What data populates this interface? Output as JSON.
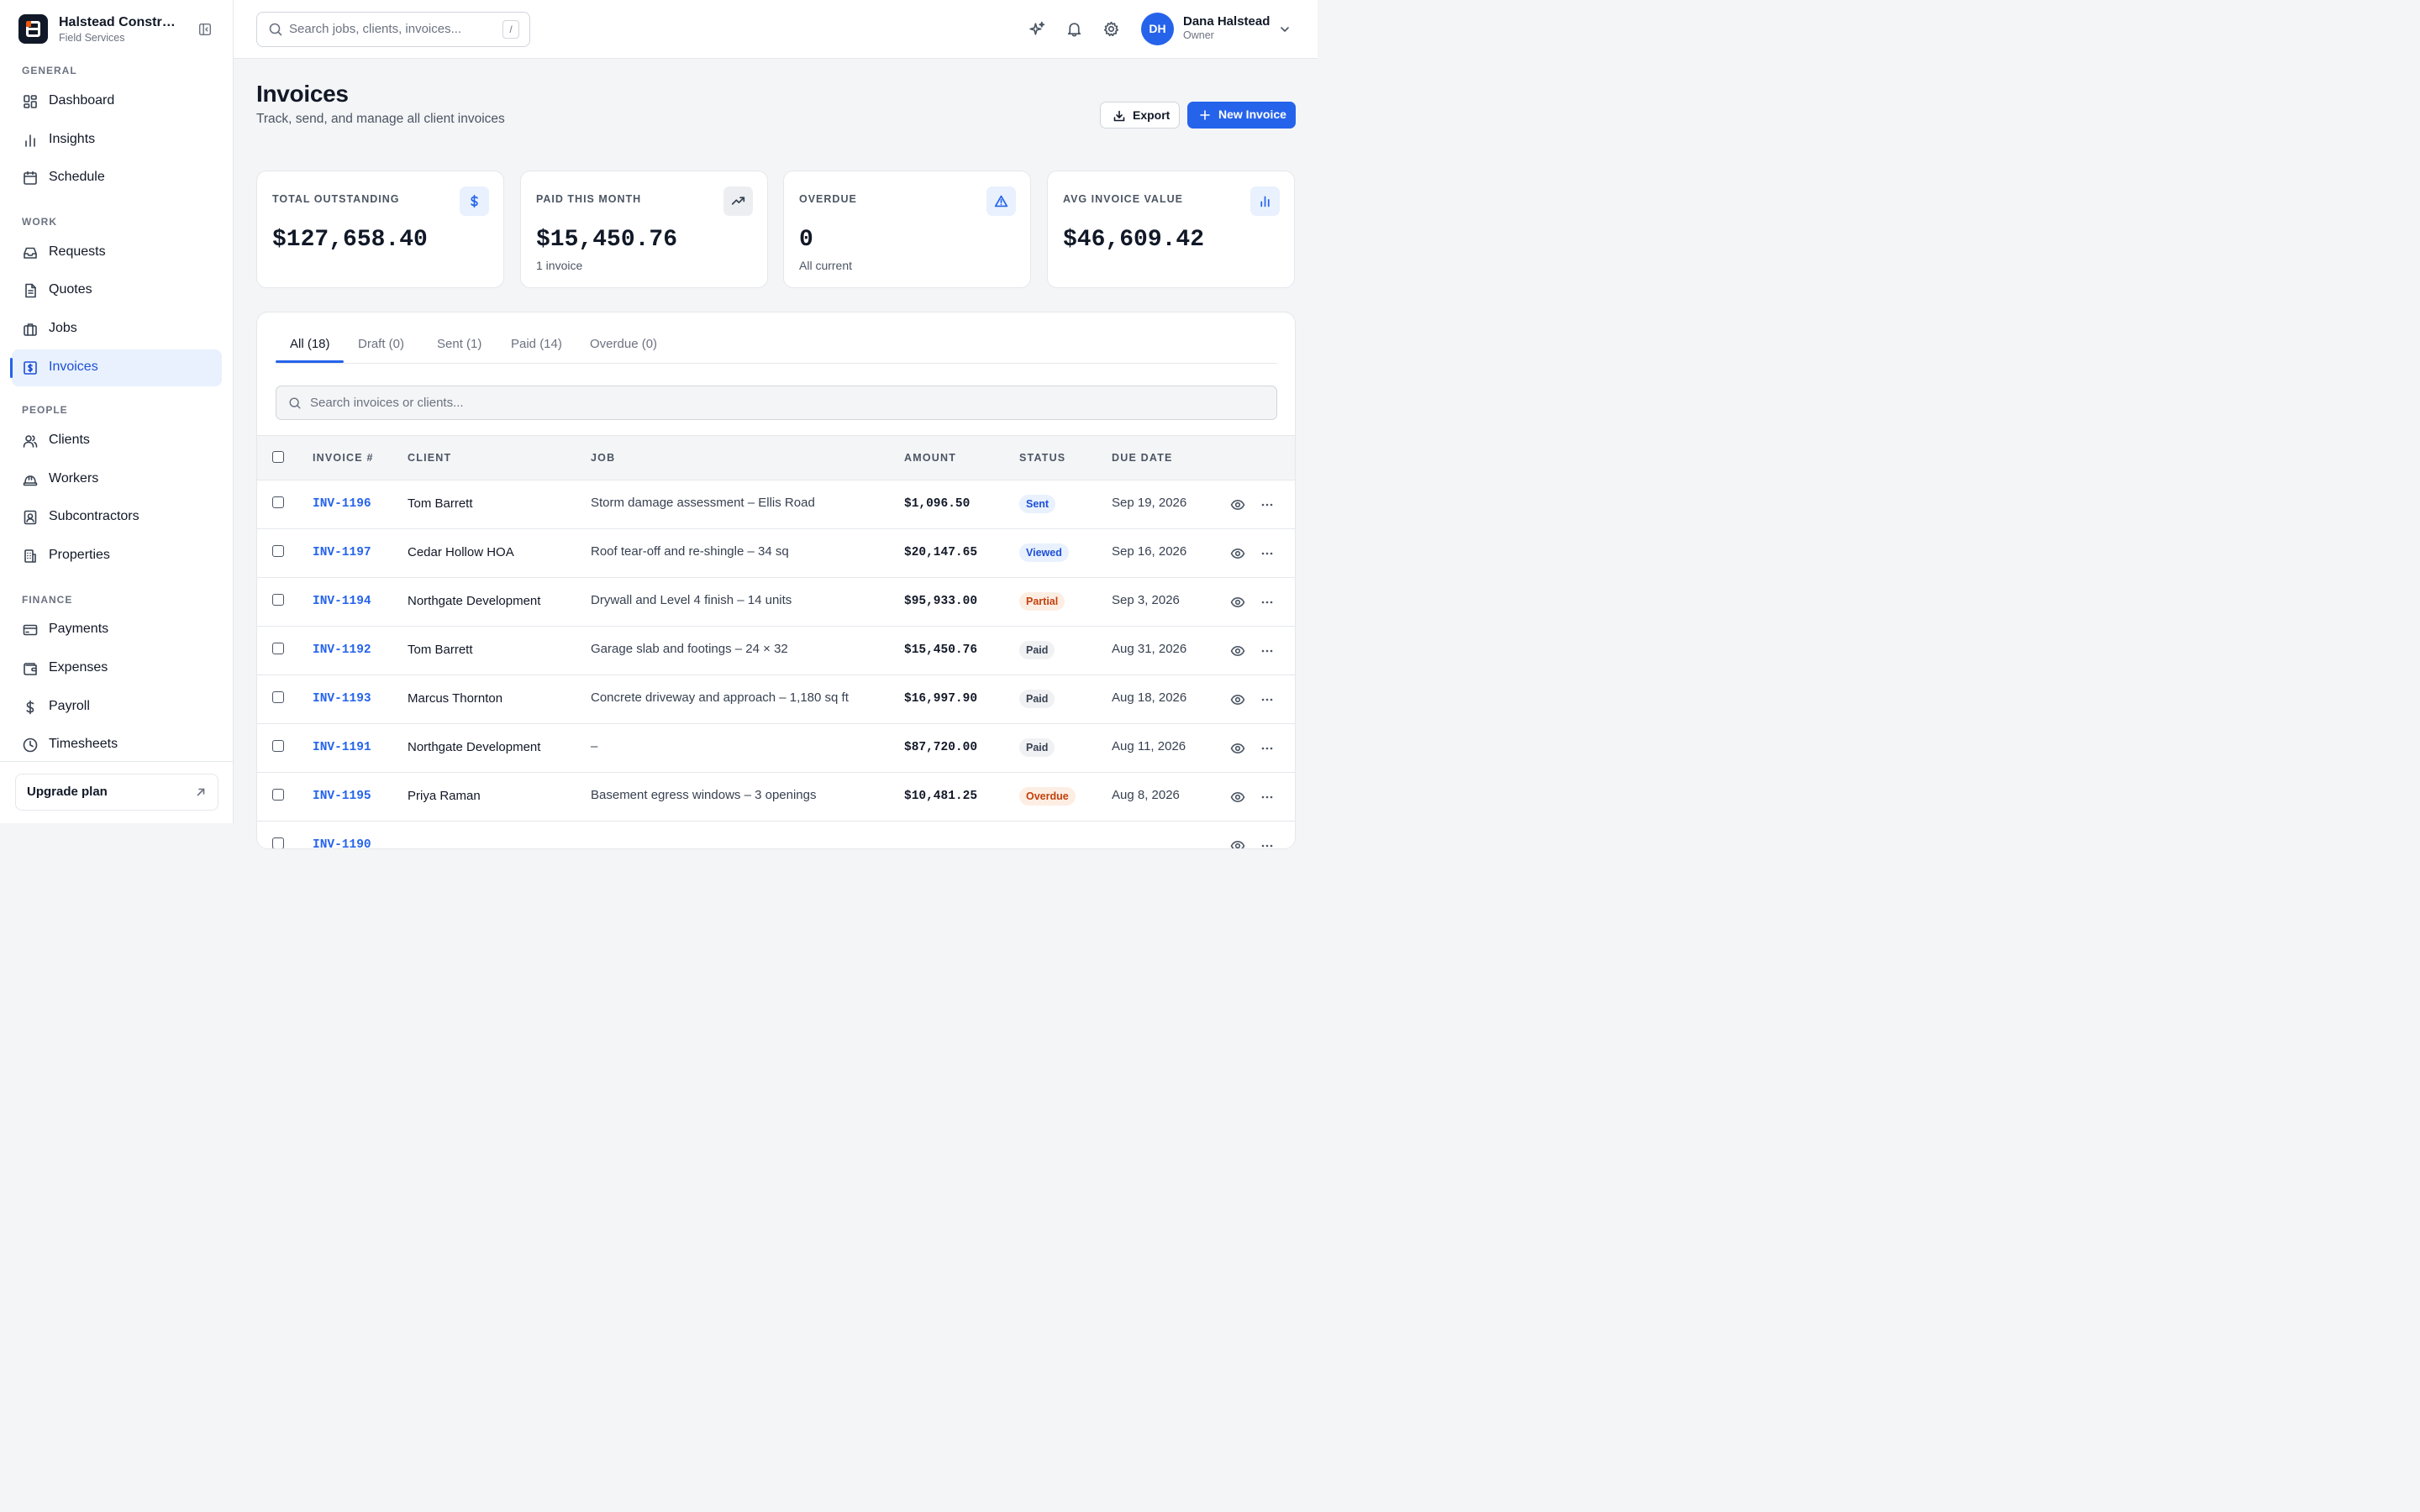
{
  "brand": {
    "name": "Halstead Construction",
    "subtitle": "Field Services"
  },
  "nav": {
    "sections": [
      {
        "label": "GENERAL",
        "items": [
          {
            "label": "Dashboard",
            "icon": "grid-icon"
          },
          {
            "label": "Insights",
            "icon": "bar-chart-icon"
          },
          {
            "label": "Schedule",
            "icon": "calendar-icon"
          }
        ]
      },
      {
        "label": "WORK",
        "items": [
          {
            "label": "Requests",
            "icon": "inbox-icon"
          },
          {
            "label": "Quotes",
            "icon": "document-icon"
          },
          {
            "label": "Jobs",
            "icon": "briefcase-icon"
          },
          {
            "label": "Invoices",
            "icon": "invoice-icon",
            "active": true
          }
        ]
      },
      {
        "label": "PEOPLE",
        "items": [
          {
            "label": "Clients",
            "icon": "users-icon"
          },
          {
            "label": "Workers",
            "icon": "hard-hat-icon"
          },
          {
            "label": "Subcontractors",
            "icon": "contact-card-icon"
          },
          {
            "label": "Properties",
            "icon": "building-icon"
          }
        ]
      },
      {
        "label": "FINANCE",
        "items": [
          {
            "label": "Payments",
            "icon": "credit-card-icon"
          },
          {
            "label": "Expenses",
            "icon": "wallet-icon"
          },
          {
            "label": "Payroll",
            "icon": "dollar-icon"
          },
          {
            "label": "Timesheets",
            "icon": "clock-icon"
          }
        ]
      }
    ],
    "upgrade_label": "Upgrade plan"
  },
  "topbar": {
    "search_placeholder": "Search jobs, clients, invoices...",
    "search_shortcut": "/",
    "user": {
      "initials": "DH",
      "name": "Dana Halstead",
      "role": "Owner"
    }
  },
  "page": {
    "title": "Invoices",
    "subtitle": "Track, send, and manage all client invoices",
    "export_label": "Export",
    "new_label": "New Invoice"
  },
  "stats": [
    {
      "label": "TOTAL OUTSTANDING",
      "value": "$127,658.40",
      "sub": "",
      "icon": "dollar-icon",
      "icon_bg": "#e8f1fd",
      "icon_color": "#2563eb"
    },
    {
      "label": "PAID THIS MONTH",
      "value": "$15,450.76",
      "sub": "1 invoice",
      "icon": "trending-up-icon",
      "icon_bg": "#eceef1",
      "icon_color": "#374151"
    },
    {
      "label": "OVERDUE",
      "value": "0",
      "sub": "All current",
      "icon": "alert-triangle-icon",
      "icon_bg": "#e8f1fd",
      "icon_color": "#2563eb"
    },
    {
      "label": "AVG INVOICE VALUE",
      "value": "$46,609.42",
      "sub": "",
      "icon": "bar-chart-icon",
      "icon_bg": "#e8f1fd",
      "icon_color": "#2563eb"
    }
  ],
  "tabs": [
    "All (18)",
    "Draft (0)",
    "Sent (1)",
    "Paid (14)",
    "Overdue (0)"
  ],
  "table_search_placeholder": "Search invoices or clients...",
  "columns": {
    "invoice": "INVOICE #",
    "client": "CLIENT",
    "job": "JOB",
    "amount": "AMOUNT",
    "status": "STATUS",
    "due": "DUE DATE"
  },
  "rows": [
    {
      "invoice": "INV-1196",
      "client": "Tom Barrett",
      "job": "Storm damage assessment – Ellis Road",
      "amount": "$1,096.50",
      "status": "Sent",
      "status_kind": "sent",
      "due": "Sep 19, 2026"
    },
    {
      "invoice": "INV-1197",
      "client": "Cedar Hollow HOA",
      "job": "Roof tear-off and re-shingle – 34 sq",
      "amount": "$20,147.65",
      "status": "Viewed",
      "status_kind": "viewed",
      "due": "Sep 16, 2026"
    },
    {
      "invoice": "INV-1194",
      "client": "Northgate Development",
      "job": "Drywall and Level 4 finish – 14 units",
      "amount": "$95,933.00",
      "status": "Partial",
      "status_kind": "partial",
      "due": "Sep 3, 2026"
    },
    {
      "invoice": "INV-1192",
      "client": "Tom Barrett",
      "job": "Garage slab and footings – 24 × 32",
      "amount": "$15,450.76",
      "status": "Paid",
      "status_kind": "paid",
      "due": "Aug 31, 2026"
    },
    {
      "invoice": "INV-1193",
      "client": "Marcus Thornton",
      "job": "Concrete driveway and approach – 1,180 sq ft",
      "amount": "$16,997.90",
      "status": "Paid",
      "status_kind": "paid",
      "due": "Aug 18, 2026"
    },
    {
      "invoice": "INV-1191",
      "client": "Northgate Development",
      "job": "–",
      "amount": "$87,720.00",
      "status": "Paid",
      "status_kind": "paid",
      "due": "Aug 11, 2026"
    },
    {
      "invoice": "INV-1195",
      "client": "Priya Raman",
      "job": "Basement egress windows – 3 openings",
      "amount": "$10,481.25",
      "status": "Overdue",
      "status_kind": "overdue",
      "due": "Aug 8, 2026"
    },
    {
      "invoice": "INV-1190",
      "client": "",
      "job": "",
      "amount": "",
      "status": "",
      "status_kind": "paid",
      "due": ""
    }
  ]
}
